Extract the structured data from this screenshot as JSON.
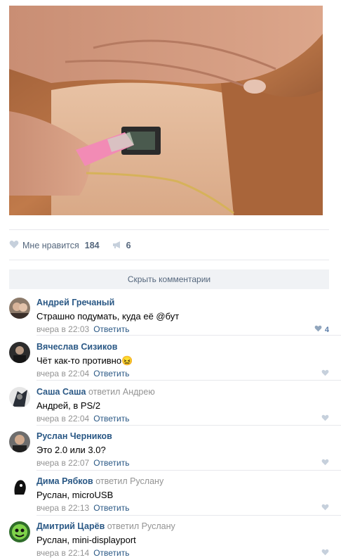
{
  "post": {
    "likes_label": "Мне нравится",
    "likes_count": "184",
    "shares_count": "6"
  },
  "comments_toggle": "Скрыть комментарии",
  "reply_label": "Ответить",
  "comments": [
    {
      "author": "Андрей Гречаный",
      "replied_to": "",
      "text": "Страшно подумать, куда её @бут",
      "time": "вчера в 22:03",
      "likes": "4"
    },
    {
      "author": "Вячеслав Сизиков",
      "replied_to": "",
      "text": "Чёт как-то противно😖",
      "time": "вчера в 22:04",
      "likes": ""
    },
    {
      "author": "Саша Саша",
      "replied_to": "ответил Андрею",
      "text": "Андрей, в PS/2",
      "time": "вчера в 22:04",
      "likes": ""
    },
    {
      "author": "Руслан Черников",
      "replied_to": "",
      "text": "Это 2.0 или 3.0?",
      "time": "вчера в 22:07",
      "likes": ""
    },
    {
      "author": "Дима Рябков",
      "replied_to": "ответил Руслану",
      "text": "Руслан, microUSB",
      "time": "вчера в 22:13",
      "likes": ""
    },
    {
      "author": "Дмитрий Царёв",
      "replied_to": "ответил Руслану",
      "text": "Руслан, mini-displayport",
      "time": "вчера в 22:14",
      "likes": ""
    }
  ]
}
